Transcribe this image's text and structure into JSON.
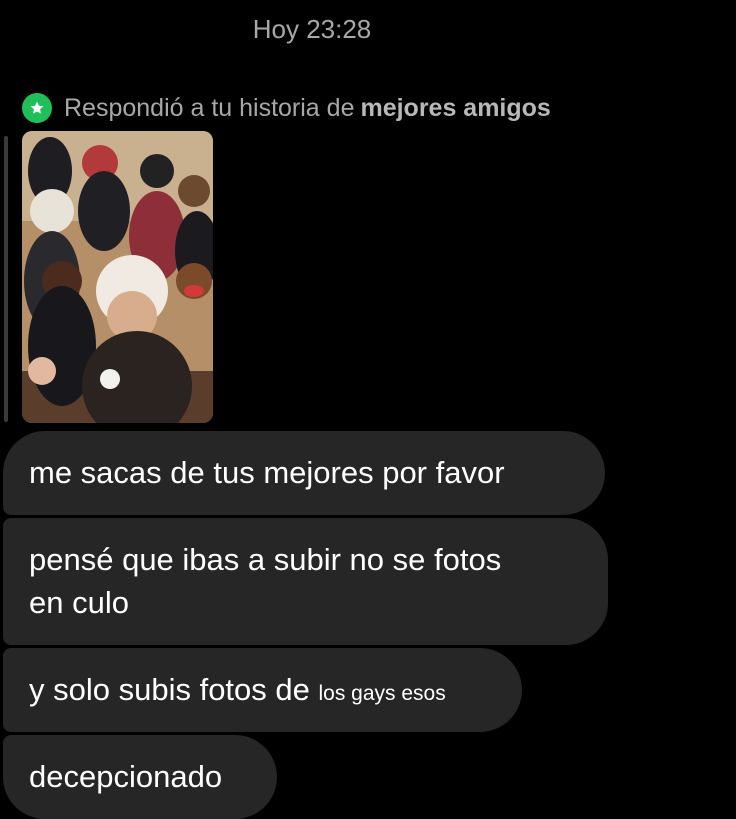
{
  "header": {
    "timestamp": "Hoy 23:28"
  },
  "reply": {
    "prefix": "Respondió a tu historia de ",
    "highlight": "mejores amigos",
    "badge_icon": "star-icon",
    "badge_color": "#1fc05a"
  },
  "messages": [
    {
      "text": "me sacas de tus mejores por favor"
    },
    {
      "line1": "pensé que ibas a subir no se fotos",
      "line2": "en culo"
    },
    {
      "text": "y solo subis fotos de ",
      "small": "los gays esos"
    },
    {
      "text": "decepcionado"
    }
  ],
  "colors": {
    "background": "#000000",
    "bubble": "#262626",
    "muted_text": "#a8a8a8"
  }
}
